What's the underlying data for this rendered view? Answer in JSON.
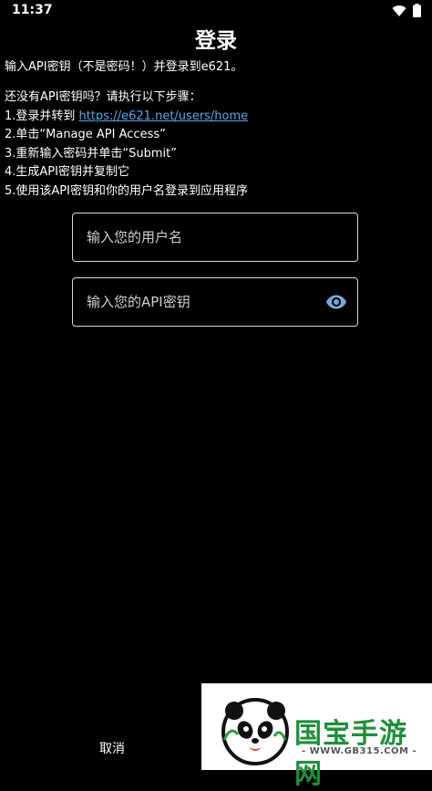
{
  "status_bar": {
    "time": "11:37",
    "icons": [
      "wifi-icon",
      "battery-icon"
    ]
  },
  "page": {
    "title": "登录",
    "intro": "输入API密钥（不是密码！）并登录到e621。"
  },
  "steps": {
    "heading": "还没有API密钥吗？请执行以下步骤：",
    "step1_prefix": "1.登录并转到 ",
    "step1_link": "https://e621.net/users/home",
    "step2": "2.单击“Manage API Access”",
    "step3": "3.重新输入密码并单击“Submit”",
    "step4": "4.生成API密钥并复制它",
    "step5": "5.使用该API密钥和你的用户名登录到应用程序"
  },
  "form": {
    "username_placeholder": "输入您的用户名",
    "username_value": "",
    "apikey_placeholder": "输入您的API密钥",
    "apikey_value": ""
  },
  "actions": {
    "cancel_label": "取消"
  },
  "watermark": {
    "title": "国宝手游网",
    "url": "- WWW.GB315.COM -"
  },
  "colors": {
    "background": "#000000",
    "link": "#5aa7e6",
    "eye_icon": "#7aa5dc",
    "watermark_green": "#1f8f3a"
  }
}
